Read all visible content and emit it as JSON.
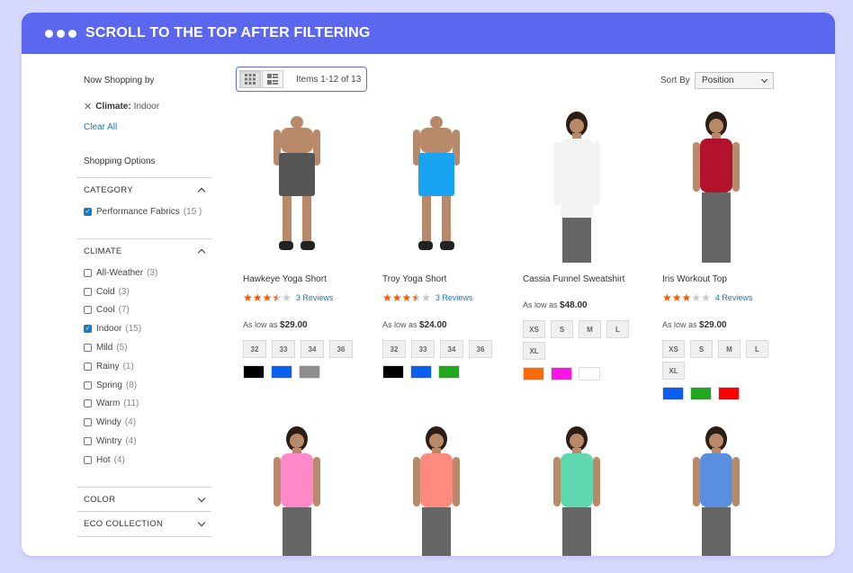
{
  "banner": {
    "title": "SCROLL TO THE TOP AFTER FILTERING"
  },
  "sidebar": {
    "now_shopping": "Now Shopping by",
    "active_filter": {
      "label": "Climate:",
      "value": "Indoor"
    },
    "clear_all": "Clear All",
    "shopping_options": "Shopping Options",
    "category": {
      "title": "CATEGORY",
      "options": [
        {
          "label": "Performance Fabrics",
          "count": "(15 )",
          "checked": true
        }
      ]
    },
    "climate": {
      "title": "CLIMATE",
      "options": [
        {
          "label": "All-Weather",
          "count": "(3)",
          "checked": false
        },
        {
          "label": "Cold",
          "count": "(3)",
          "checked": false
        },
        {
          "label": "Cool",
          "count": "(7)",
          "checked": false
        },
        {
          "label": "Indoor",
          "count": "(15)",
          "checked": true
        },
        {
          "label": "Mild",
          "count": "(5)",
          "checked": false
        },
        {
          "label": "Rainy",
          "count": "(1)",
          "checked": false
        },
        {
          "label": "Spring",
          "count": "(8)",
          "checked": false
        },
        {
          "label": "Warm",
          "count": "(11)",
          "checked": false
        },
        {
          "label": "Windy",
          "count": "(4)",
          "checked": false
        },
        {
          "label": "Wintry",
          "count": "(4)",
          "checked": false
        },
        {
          "label": "Hot",
          "count": "(4)",
          "checked": false
        }
      ]
    },
    "color": {
      "title": "COLOR"
    },
    "eco": {
      "title": "ECO COLLECTION"
    }
  },
  "toolbar": {
    "items_count": "Items 1-12 of 13",
    "sort_by_label": "Sort By",
    "sort_value": "Position"
  },
  "products": [
    {
      "name": "Hawkeye Yoga Short",
      "rating": 3.5,
      "reviews": "3  Reviews",
      "price_prefix": "As low as",
      "price": "$29.00",
      "sizes": [
        "32",
        "33",
        "34",
        "36"
      ],
      "colors": [
        "#000000",
        "#0a5ef0",
        "#8e8e8e"
      ]
    },
    {
      "name": "Troy Yoga Short",
      "rating": 3.5,
      "reviews": "3  Reviews",
      "price_prefix": "As low as",
      "price": "$24.00",
      "sizes": [
        "32",
        "33",
        "34",
        "36"
      ],
      "colors": [
        "#000000",
        "#0a5ef0",
        "#22a81e"
      ]
    },
    {
      "name": "Cassia Funnel Sweatshirt",
      "rating": 0,
      "reviews": "",
      "price_prefix": "As low as",
      "price": "$48.00",
      "sizes": [
        "XS",
        "S",
        "M",
        "L",
        "XL"
      ],
      "colors": [
        "#ff6a00",
        "#ff14e6",
        "#ffffff"
      ]
    },
    {
      "name": "Iris Workout Top",
      "rating": 3,
      "reviews": "4  Reviews",
      "price_prefix": "As low as",
      "price": "$29.00",
      "sizes": [
        "XS",
        "S",
        "M",
        "L",
        "XL"
      ],
      "colors": [
        "#0a5ef0",
        "#22a81e",
        "#ff0000"
      ]
    }
  ],
  "row2_products": [
    {
      "name": ""
    },
    {
      "name": ""
    },
    {
      "name": ""
    },
    {
      "name": ""
    }
  ]
}
